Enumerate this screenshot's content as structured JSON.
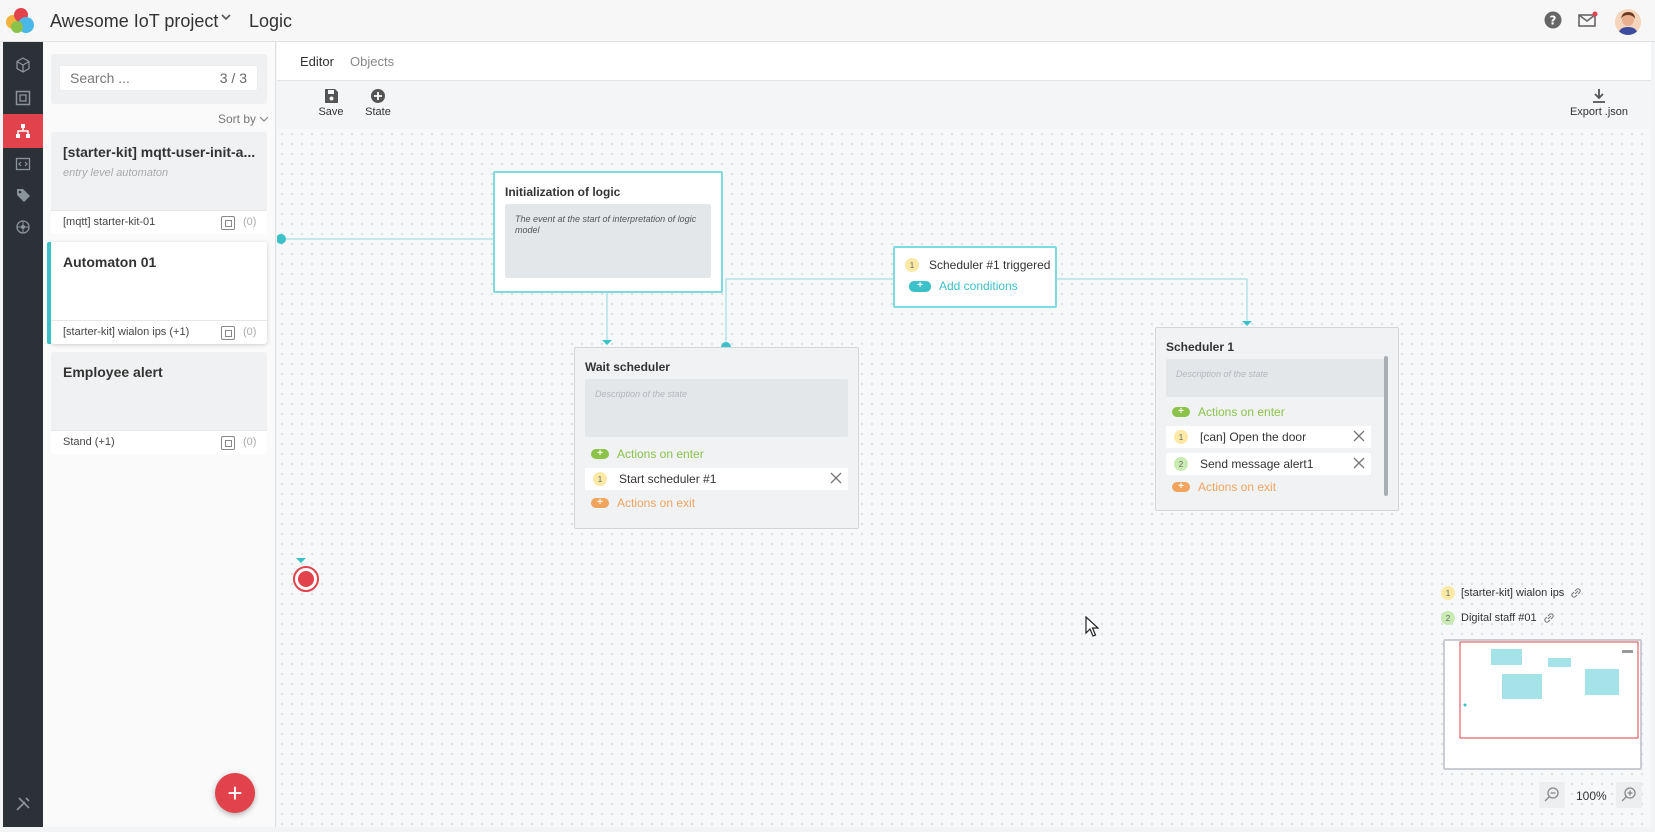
{
  "header": {
    "project_name": "Awesome IoT project",
    "page_title": "Logic"
  },
  "search": {
    "placeholder": "Search ...",
    "count": "3 / 3"
  },
  "sort_by": "Sort by",
  "automata": [
    {
      "title": "[starter-kit] mqtt-user-init-a...",
      "subtitle": "entry level automaton",
      "object": "[mqtt] starter-kit-01",
      "count": "(0)"
    },
    {
      "title": "Automaton 01",
      "subtitle": "",
      "object": "[starter-kit] wialon ips (+1)",
      "count": "(0)"
    },
    {
      "title": "Employee alert",
      "subtitle": "",
      "object": "Stand (+1)",
      "count": "(0)"
    }
  ],
  "tabs": {
    "editor": "Editor",
    "objects": "Objects"
  },
  "toolbar": {
    "save": "Save",
    "state": "State",
    "export": "Export .json"
  },
  "canvas": {
    "init": {
      "title": "Initialization of logic",
      "description": "The event at the start of interpretation of logic model"
    },
    "transition": {
      "num": "1",
      "title": "Scheduler #1 triggered",
      "add_conditions": "Add conditions"
    },
    "wait": {
      "title": "Wait scheduler",
      "description": "Description of the state",
      "on_enter": "Actions on enter",
      "actions": [
        {
          "num": "1",
          "label": "Start scheduler #1"
        }
      ],
      "on_exit": "Actions on exit"
    },
    "scheduler1": {
      "title": "Scheduler 1",
      "description": "Description of the state",
      "on_enter": "Actions on enter",
      "actions": [
        {
          "num": "1",
          "label": "[can] Open the door"
        },
        {
          "num": "2",
          "label": "Send message alert1"
        }
      ],
      "on_exit": "Actions on exit"
    }
  },
  "legend": [
    {
      "num": "1",
      "label": "[starter-kit] wialon ips"
    },
    {
      "num": "2",
      "label": "Digital staff #01"
    }
  ],
  "zoom": "100%",
  "colors": {
    "accent": "#e2424b",
    "teal": "#3cc1c9",
    "enter_green": "#8bc34a",
    "exit_orange": "#f0a45e"
  }
}
